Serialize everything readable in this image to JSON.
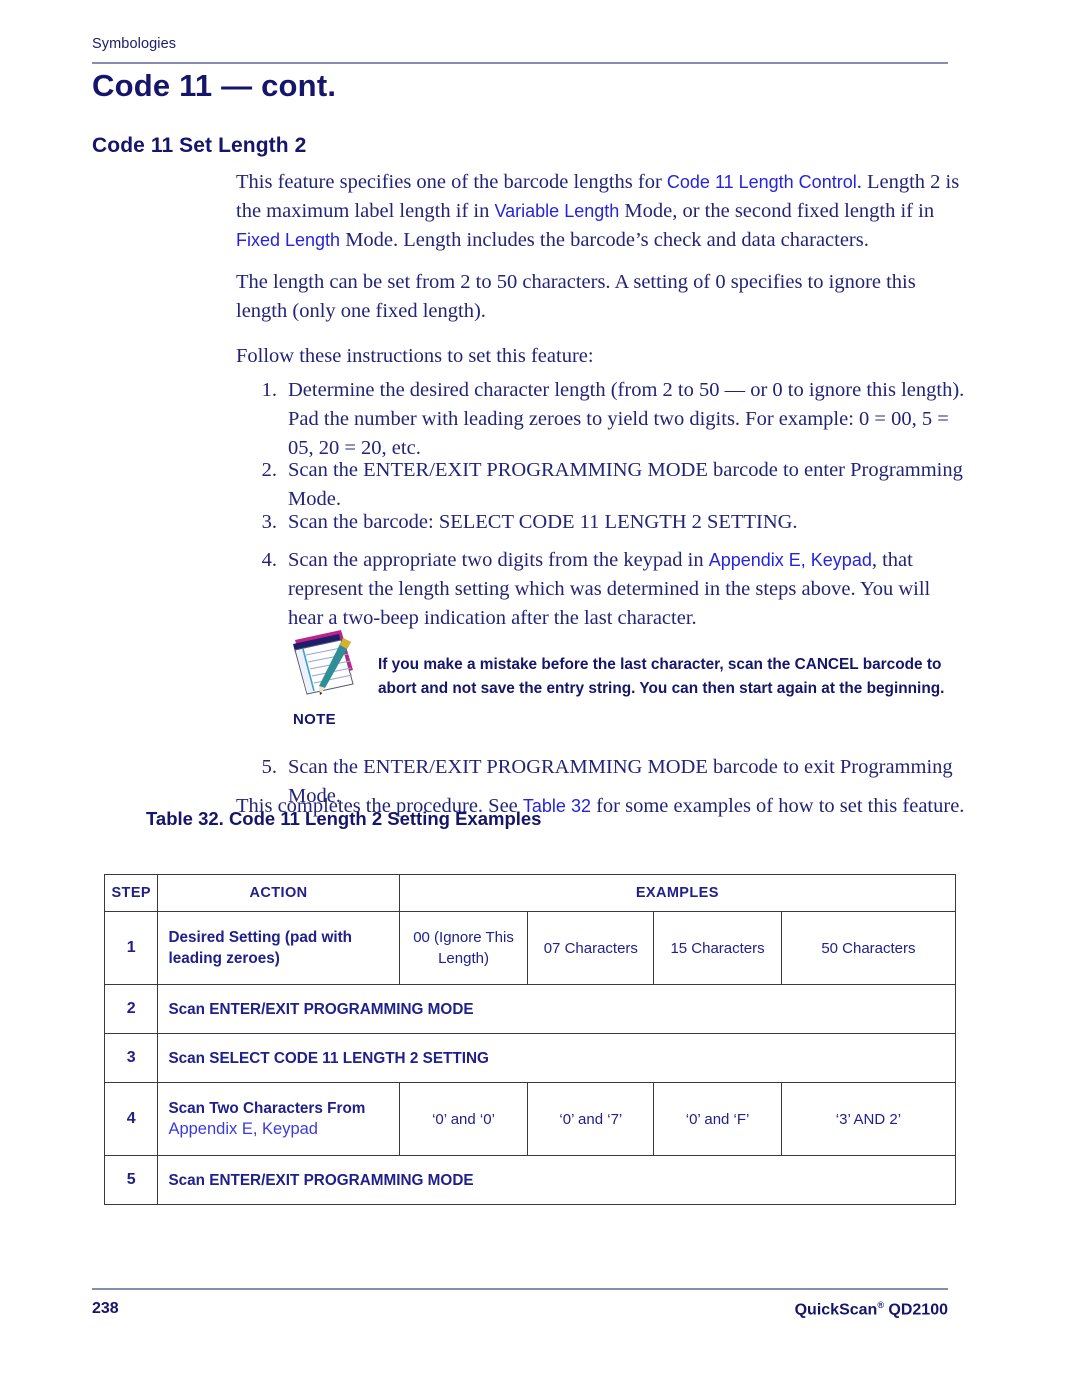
{
  "header": {
    "running_head": "Symbologies",
    "chapter_title": "Code 11 — cont.",
    "section_title": "Code 11 Set Length 2"
  },
  "body": {
    "para1_a": "This feature specifies one of the barcode lengths for ",
    "para1_link1": "Code 11 Length Control",
    "para1_b": ". Length 2 is the maximum label length if in ",
    "para1_link2": "Variable Length",
    "para1_c": " Mode, or the second fixed length if in ",
    "para1_link3": "Fixed Length",
    "para1_d": " Mode. Length includes the barcode’s check and data characters.",
    "para2": "The length can be set from 2 to 50 characters. A setting of 0 specifies to ignore this length (only one fixed length).",
    "para3": "Follow these instructions to set this feature:",
    "closing_a": "This completes the procedure. See ",
    "closing_link": "Table 32",
    "closing_b": " for some examples of how to set this feature."
  },
  "steps": [
    {
      "num": "1.",
      "text": "Determine the desired character length (from 2 to 50 — or 0 to ignore this length). Pad the number with leading zeroes to yield two digits. For example: 0 = 00, 5 = 05, 20 = 20, etc."
    },
    {
      "num": "2.",
      "text": "Scan the ENTER/EXIT PROGRAMMING MODE barcode to enter Programming Mode."
    },
    {
      "num": "3.",
      "text": "Scan the barcode: SELECT CODE 11 LENGTH 2 SETTING."
    },
    {
      "num": "4.",
      "text_a": "Scan the appropriate two digits from the keypad in ",
      "link": "Appendix E, Keypad",
      "text_b": ", that represent the length setting which was determined in the steps above. You will hear a two-beep indication after the last character."
    },
    {
      "num": "5.",
      "text": "Scan the ENTER/EXIT PROGRAMMING MODE barcode to exit Programming Mode."
    }
  ],
  "note": {
    "label": "NOTE",
    "text": "If you make a mistake before the last character, scan the CANCEL barcode to abort and not save the entry string. You can then start again at the beginning.",
    "icon": "notepad-pencil-icon"
  },
  "table": {
    "caption": "Table 32. Code 11 Length 2 Setting Examples",
    "headers": {
      "step": "STEP",
      "action": "ACTION",
      "examples": "EXAMPLES"
    },
    "rows": [
      {
        "step": "1",
        "action": "Desired Setting (pad with leading zeroes)",
        "examples": [
          "00 (Ignore This Length)",
          "07 Characters",
          "15 Characters",
          "50 Characters"
        ]
      },
      {
        "step": "2",
        "action": "Scan ENTER/EXIT PROGRAMMING MODE",
        "examples": []
      },
      {
        "step": "3",
        "action": "Scan SELECT CODE 11 LENGTH 2 SETTING",
        "examples": []
      },
      {
        "step": "4",
        "action": "Scan Two Characters From",
        "action_link": "Appendix E, Keypad",
        "examples": [
          "‘0’ and ‘0’",
          "‘0’ and ‘7’",
          "‘0’ and ‘F’",
          "‘3’ AND 2’"
        ]
      },
      {
        "step": "5",
        "action": "Scan ENTER/EXIT PROGRAMMING MODE",
        "examples": []
      }
    ]
  },
  "footer": {
    "page_number": "238",
    "product": "QuickScan",
    "model": " QD2100",
    "registered_mark": "®"
  },
  "colors": {
    "navy": "#15156b",
    "body_navy": "#232378",
    "link_blue": "#2424e0",
    "rule": "#8a8ab4"
  }
}
